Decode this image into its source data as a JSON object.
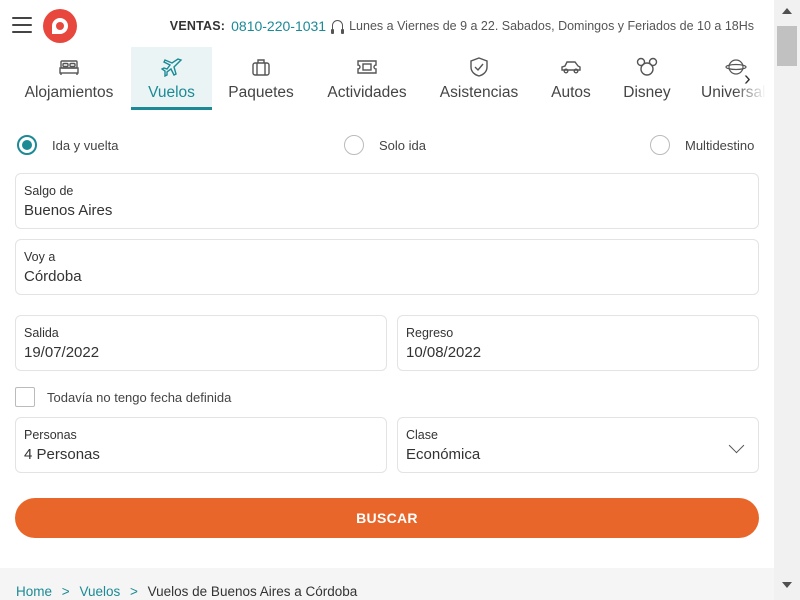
{
  "header": {
    "sales_label": "VENTAS:",
    "phone": "0810-220-1031",
    "hours": "Lunes a Viernes de 9 a 22. Sabados, Domingos y Feriados de 10 a 18Hs"
  },
  "tabs": [
    {
      "label": "Alojamientos",
      "icon": "bed-icon"
    },
    {
      "label": "Vuelos",
      "icon": "plane-icon",
      "active": true
    },
    {
      "label": "Paquetes",
      "icon": "suitcase-icon"
    },
    {
      "label": "Actividades",
      "icon": "ticket-icon"
    },
    {
      "label": "Asistencias",
      "icon": "shield-icon"
    },
    {
      "label": "Autos",
      "icon": "car-icon"
    },
    {
      "label": "Disney",
      "icon": "mickey-icon"
    },
    {
      "label": "Universal",
      "icon": "universal-globe-icon"
    }
  ],
  "trip_type": {
    "options": [
      "Ida y vuelta",
      "Solo ida",
      "Multidestino"
    ],
    "selected": "Ida y vuelta"
  },
  "form": {
    "origin_label": "Salgo de",
    "origin_value": "Buenos Aires",
    "destination_label": "Voy a",
    "destination_value": "Córdoba",
    "departure_label": "Salida",
    "departure_value": "19/07/2022",
    "return_label": "Regreso",
    "return_value": "10/08/2022",
    "no_date_label": "Todavía no tengo fecha definida",
    "passengers_label": "Personas",
    "passengers_value": "4 Personas",
    "class_label": "Clase",
    "class_value": "Económica",
    "search_button": "BUSCAR"
  },
  "breadcrumb": {
    "home": "Home",
    "section": "Vuelos",
    "current": "Vuelos de Buenos Aires a Córdoba",
    "separator": ">"
  },
  "colors": {
    "accent": "#1b8a95",
    "button": "#e8662a",
    "logo": "#e8473e"
  }
}
